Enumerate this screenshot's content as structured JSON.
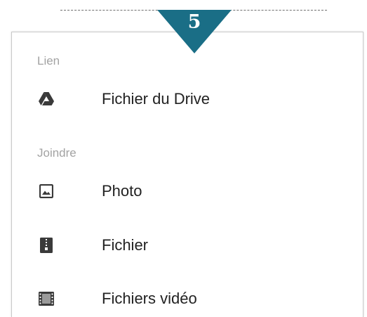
{
  "step": {
    "number": "5",
    "color": "#1a6e86"
  },
  "menu": {
    "sections": [
      {
        "header": "Lien",
        "items": [
          {
            "label": "Fichier du Drive",
            "icon": "google-drive-icon"
          }
        ]
      },
      {
        "header": "Joindre",
        "items": [
          {
            "label": "Photo",
            "icon": "photo-icon"
          },
          {
            "label": "Fichier",
            "icon": "zip-file-icon"
          },
          {
            "label": "Fichiers vidéo",
            "icon": "video-file-icon"
          }
        ]
      }
    ]
  },
  "colors": {
    "section_header": "#a3a3a3",
    "item_text": "#222222",
    "icon": "#3a3a3a"
  }
}
